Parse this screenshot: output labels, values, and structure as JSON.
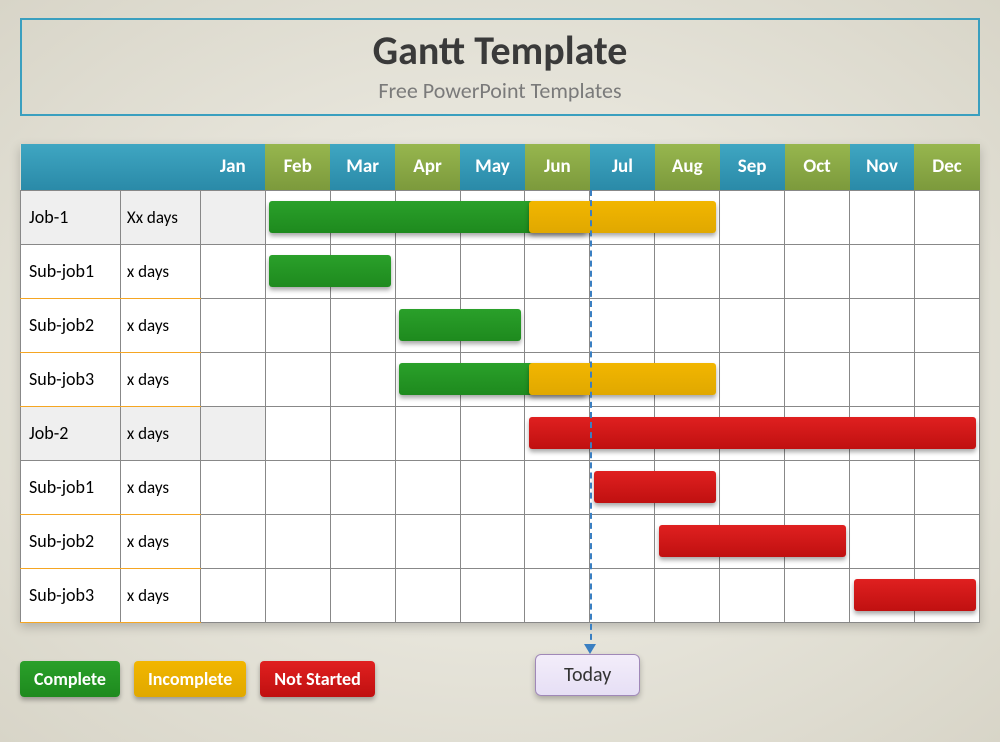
{
  "title": "Gantt Template",
  "subtitle": "Free PowerPoint Templates",
  "months": [
    "Jan",
    "Feb",
    "Mar",
    "Apr",
    "May",
    "Jun",
    "Jul",
    "Aug",
    "Sep",
    "Oct",
    "Nov",
    "Dec"
  ],
  "rows": [
    {
      "name": "Job-1",
      "duration": "Xx days",
      "main": true
    },
    {
      "name": "Sub-job1",
      "duration": "x days",
      "main": false
    },
    {
      "name": "Sub-job2",
      "duration": "x days",
      "main": false
    },
    {
      "name": "Sub-job3",
      "duration": "x days",
      "main": false
    },
    {
      "name": "Job-2",
      "duration": "x days",
      "main": true
    },
    {
      "name": "Sub-job1",
      "duration": "x days",
      "main": false
    },
    {
      "name": "Sub-job2",
      "duration": "x days",
      "main": false
    },
    {
      "name": "Sub-job3",
      "duration": "x days",
      "main": false
    }
  ],
  "legend": {
    "complete": "Complete",
    "incomplete": "Incomplete",
    "notstarted": "Not Started"
  },
  "today_label": "Today",
  "chart_data": {
    "type": "gantt",
    "title": "Gantt Template",
    "x_categories": [
      "Jan",
      "Feb",
      "Mar",
      "Apr",
      "May",
      "Jun",
      "Jul",
      "Aug",
      "Sep",
      "Oct",
      "Nov",
      "Dec"
    ],
    "today_marker_after_month": "Jun",
    "status_legend": {
      "green": "Complete",
      "amber": "Incomplete",
      "red": "Not Started"
    },
    "tasks": [
      {
        "id": "Job-1",
        "level": 0,
        "segments": [
          {
            "start": "Feb",
            "end": "Jun",
            "status": "Complete"
          },
          {
            "start": "Jun",
            "end": "Aug",
            "status": "Incomplete"
          }
        ]
      },
      {
        "id": "Sub-job1",
        "level": 1,
        "parent": "Job-1",
        "segments": [
          {
            "start": "Feb",
            "end": "Mar",
            "status": "Complete"
          }
        ]
      },
      {
        "id": "Sub-job2",
        "level": 1,
        "parent": "Job-1",
        "segments": [
          {
            "start": "Apr",
            "end": "May",
            "status": "Complete"
          }
        ]
      },
      {
        "id": "Sub-job3",
        "level": 1,
        "parent": "Job-1",
        "segments": [
          {
            "start": "Apr",
            "end": "Jun",
            "status": "Complete"
          },
          {
            "start": "Jun",
            "end": "Aug",
            "status": "Incomplete"
          }
        ]
      },
      {
        "id": "Job-2",
        "level": 0,
        "segments": [
          {
            "start": "Jun",
            "end": "Dec",
            "status": "Not Started"
          }
        ]
      },
      {
        "id": "Sub-job1",
        "level": 1,
        "parent": "Job-2",
        "segments": [
          {
            "start": "Jul",
            "end": "Aug",
            "status": "Not Started"
          }
        ]
      },
      {
        "id": "Sub-job2",
        "level": 1,
        "parent": "Job-2",
        "segments": [
          {
            "start": "Aug",
            "end": "Oct",
            "status": "Not Started"
          }
        ]
      },
      {
        "id": "Sub-job3",
        "level": 1,
        "parent": "Job-2",
        "segments": [
          {
            "start": "Nov",
            "end": "Dec",
            "status": "Not Started"
          }
        ]
      }
    ]
  }
}
